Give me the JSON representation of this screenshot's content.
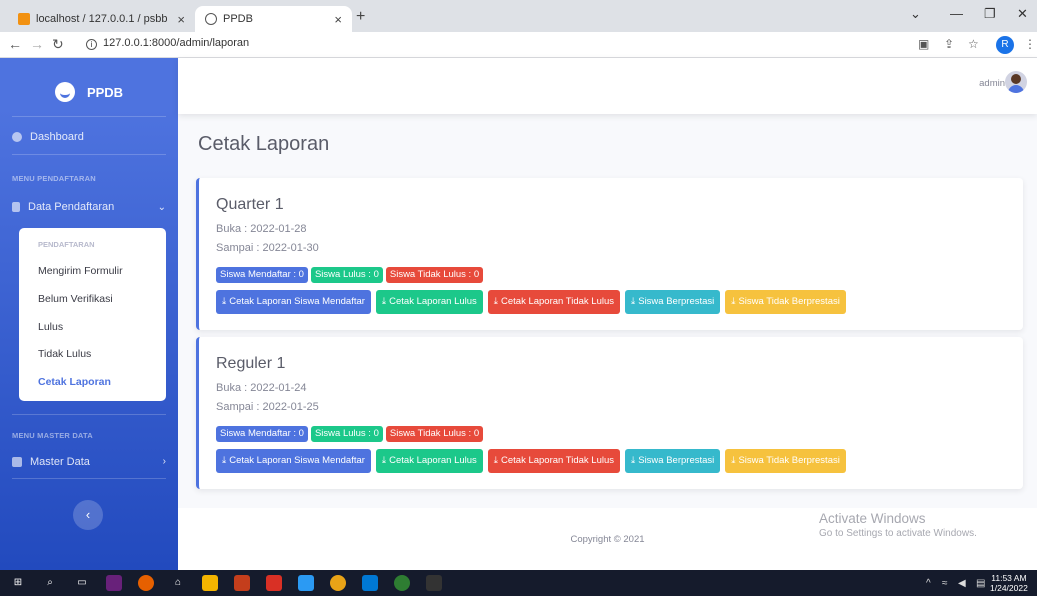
{
  "browser": {
    "tab_inactive_title": "localhost / 127.0.0.1 / psbb | php",
    "tab_active_title": "PPDB",
    "new_tab": "+",
    "close": "×",
    "url": "127.0.0.1:8000/admin/laporan",
    "profile_initial": "R"
  },
  "sidebar": {
    "brand": "PPDB",
    "dashboard": "Dashboard",
    "heading_pendaftaran": "MENU PENDAFTARAN",
    "data_pendaftaran": "Data Pendaftaran",
    "submenu_heading": "PENDAFTARAN",
    "submenu": [
      "Mengirim Formulir",
      "Belum Verifikasi",
      "Lulus",
      "Tidak Lulus",
      "Cetak Laporan"
    ],
    "heading_master": "MENU MASTER DATA",
    "master_data": "Master Data"
  },
  "topbar": {
    "user": "admin"
  },
  "page": {
    "title": "Cetak Laporan"
  },
  "cards": [
    {
      "title": "Quarter 1",
      "buka": "Buka : 2022-01-28",
      "sampai": "Sampai : 2022-01-30",
      "badges": [
        "Siswa Mendaftar : 0",
        "Siswa Lulus : 0",
        "Siswa Tidak Lulus : 0"
      ],
      "buttons": [
        "Cetak Laporan Siswa Mendaftar",
        "Cetak Laporan Lulus",
        "Cetak Laporan Tidak Lulus",
        "Siswa Berprestasi",
        "Siswa Tidak Berprestasi"
      ]
    },
    {
      "title": "Reguler 1",
      "buka": "Buka : 2022-01-24",
      "sampai": "Sampai : 2022-01-25",
      "badges": [
        "Siswa Mendaftar : 0",
        "Siswa Lulus : 0",
        "Siswa Tidak Lulus : 0"
      ],
      "buttons": [
        "Cetak Laporan Siswa Mendaftar",
        "Cetak Laporan Lulus",
        "Cetak Laporan Tidak Lulus",
        "Siswa Berprestasi",
        "Siswa Tidak Berprestasi"
      ]
    }
  ],
  "footer": {
    "copyright": "Copyright © 2021"
  },
  "watermark": {
    "line1": "Activate Windows",
    "line2": "Go to Settings to activate Windows."
  },
  "taskbar": {
    "time": "11:53 AM",
    "date": "1/24/2022"
  },
  "colors": {
    "primary": "#4e73df",
    "success": "#1cc88a",
    "danger": "#e74a3b",
    "info": "#36b9cc",
    "warning": "#f6c23e"
  }
}
